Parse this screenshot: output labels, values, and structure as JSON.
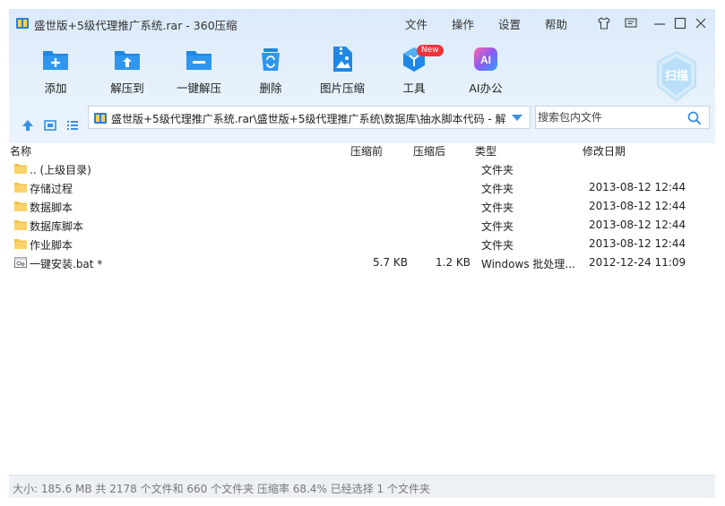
{
  "window": {
    "title": "盛世版+5级代理推广系统.rar - 360压缩"
  },
  "menu": [
    "文件",
    "操作",
    "设置",
    "帮助"
  ],
  "toolbar": [
    {
      "label": "添加",
      "icon": "add-folder-icon"
    },
    {
      "label": "解压到",
      "icon": "extract-to-icon"
    },
    {
      "label": "一键解压",
      "icon": "one-click-extract-icon"
    },
    {
      "label": "删除",
      "icon": "recycle-bin-icon"
    },
    {
      "label": "图片压缩",
      "icon": "image-compress-icon"
    },
    {
      "label": "工具",
      "icon": "tools-cube-icon"
    },
    {
      "label": "AI办公",
      "icon": "ai-office-icon"
    }
  ],
  "badge": "New",
  "scan": {
    "label": "扫描"
  },
  "address": {
    "path": "盛世版+5级代理推广系统.rar\\盛世版+5级代理推广系统\\数据库\\抽水脚本代码 - 解"
  },
  "search": {
    "placeholder": "搜索包内文件"
  },
  "columns": {
    "name": "名称",
    "before": "压缩前",
    "after": "压缩后",
    "type": "类型",
    "date": "修改日期"
  },
  "rows": [
    {
      "name": ".. (上级目录)",
      "before": "",
      "after": "",
      "type": "文件夹",
      "date": "",
      "icon": "folder-icon"
    },
    {
      "name": "存储过程",
      "before": "",
      "after": "",
      "type": "文件夹",
      "date": "2013-08-12 12:44",
      "icon": "folder-icon"
    },
    {
      "name": "数据脚本",
      "before": "",
      "after": "",
      "type": "文件夹",
      "date": "2013-08-12 12:44",
      "icon": "folder-icon"
    },
    {
      "name": "数据库脚本",
      "before": "",
      "after": "",
      "type": "文件夹",
      "date": "2013-08-12 12:44",
      "icon": "folder-icon"
    },
    {
      "name": "作业脚本",
      "before": "",
      "after": "",
      "type": "文件夹",
      "date": "2013-08-12 12:44",
      "icon": "folder-icon"
    },
    {
      "name": "一键安装.bat *",
      "before": "5.7 KB",
      "after": "1.2 KB",
      "type": "Windows 批处理...",
      "date": "2012-12-24 11:09",
      "icon": "batch-file-icon"
    }
  ],
  "status": {
    "text": "大小: 185.6 MB 共 2178 个文件和 660 个文件夹 压缩率 68.4% 已经选择 1 个文件夹"
  },
  "colors": {
    "accent": "#2a8ce6",
    "header_bg": "#e2eefb",
    "folder": "#f6c347"
  }
}
